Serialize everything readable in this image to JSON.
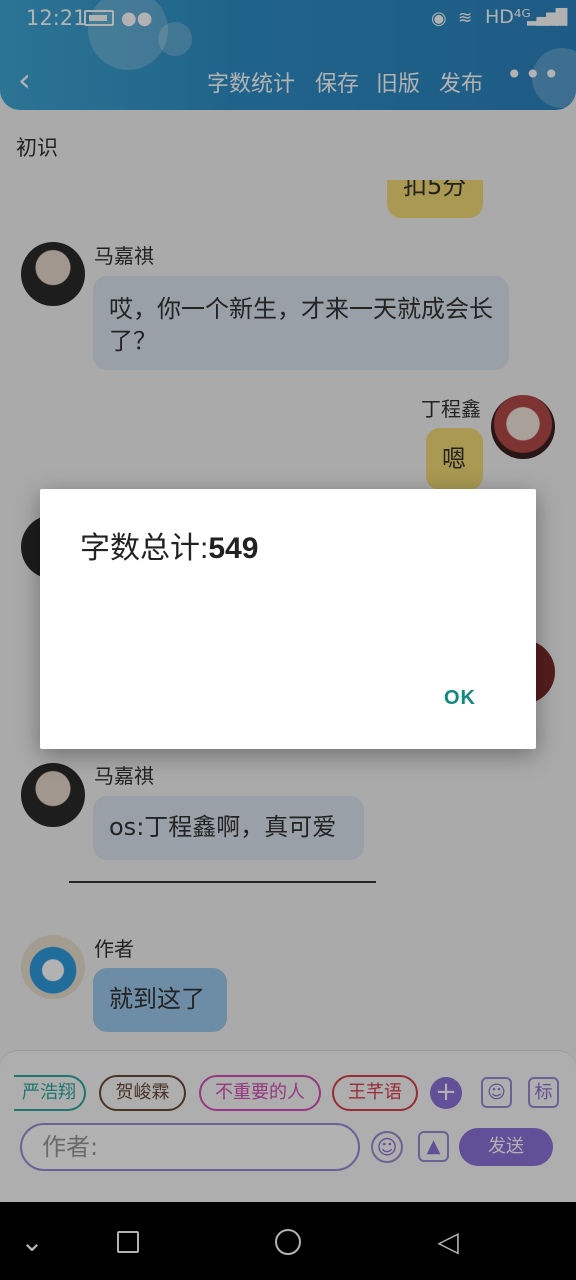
{
  "status_bar": {
    "time": "12:21",
    "network": "HD⁴ᴳ",
    "wechat_icon": "wechat-icon",
    "location_icon": "location-icon",
    "wifi_icon": "wifi-icon",
    "signal_icon": "signal-icon"
  },
  "toolbar": {
    "back_icon": "chevron-left-icon",
    "actions": [
      "字数统计",
      "保存",
      "旧版",
      "发布"
    ],
    "more": "•••",
    "accent": "#2f8fc6"
  },
  "chapter": {
    "title": "初识"
  },
  "messages": [
    {
      "side": "right",
      "text": "扣5分"
    },
    {
      "side": "left",
      "name": "马嘉祺",
      "text": "哎，你一个新生，才来一天就成会长了？"
    },
    {
      "side": "right",
      "name": "丁程鑫",
      "text": "嗯"
    },
    {
      "side": "left",
      "name": "马嘉祺",
      "text": "os:丁程鑫啊，真可爱"
    },
    {
      "side": "left",
      "name": "作者",
      "text": "就到这了"
    }
  ],
  "composer": {
    "roles": [
      {
        "label": "严浩翔",
        "color": "#2eaaa0"
      },
      {
        "label": "贺峻霖",
        "color": "#6a4a38"
      },
      {
        "label": "不重要的人",
        "color": "#d64fb9"
      },
      {
        "label": "王芊语",
        "color": "#d9404e"
      }
    ],
    "author_placeholder": "作者:",
    "send_label": "发送",
    "tag_label": "标"
  },
  "dialog": {
    "message_prefix": "字数总计:",
    "word_count": "549",
    "ok_label": "OK"
  },
  "system_nav": [
    "chevron-down-icon",
    "square-icon",
    "circle-icon",
    "triangle-back-icon"
  ]
}
